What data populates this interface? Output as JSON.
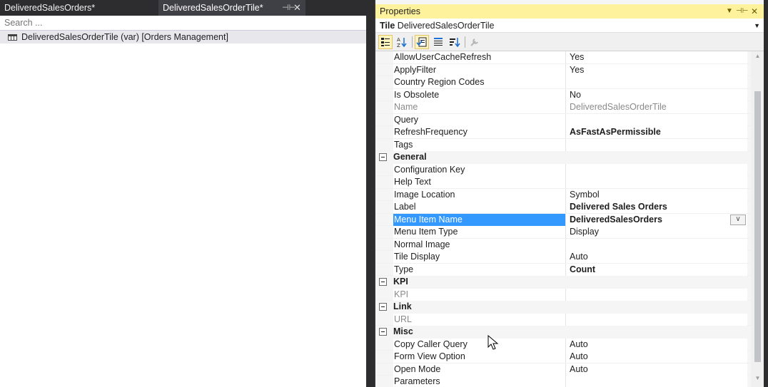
{
  "editor": {
    "tabs": [
      {
        "label": "DeliveredSalesOrders*"
      },
      {
        "label": "DeliveredSalesOrderTile*",
        "pin_icon": "pin-icon",
        "close_icon": "close-icon"
      }
    ],
    "search_placeholder": "Search ...",
    "tree_root": "DeliveredSalesOrderTile (var) [Orders Management]"
  },
  "properties": {
    "title": "Properties",
    "object_type": "Tile",
    "object_name": "DeliveredSalesOrderTile",
    "toolbar_icons": [
      "categorized-icon",
      "alphabetical-icon",
      "properties-icon",
      "events-icon",
      "sort-icon",
      "property-pages-icon"
    ],
    "rows": [
      {
        "name": "AllowUserCacheRefresh",
        "value": "Yes"
      },
      {
        "name": "ApplyFilter",
        "value": "Yes"
      },
      {
        "name": "Country Region Codes",
        "value": ""
      },
      {
        "name": "Is Obsolete",
        "value": "No"
      },
      {
        "name": "Name",
        "value": "DeliveredSalesOrderTile"
      },
      {
        "name": "Query",
        "value": ""
      },
      {
        "name": "RefreshFrequency",
        "value": "AsFastAsPermissible"
      },
      {
        "name": "Tags",
        "value": ""
      }
    ],
    "categories": {
      "general": {
        "label": "General",
        "rows": [
          {
            "name": "Configuration Key",
            "value": ""
          },
          {
            "name": "Help Text",
            "value": ""
          },
          {
            "name": "Image Location",
            "value": "Symbol"
          },
          {
            "name": "Label",
            "value": "Delivered Sales Orders"
          },
          {
            "name": "Menu Item Name",
            "value": "DeliveredSalesOrders"
          },
          {
            "name": "Menu Item Type",
            "value": "Display"
          },
          {
            "name": "Normal Image",
            "value": ""
          },
          {
            "name": "Tile Display",
            "value": "Auto"
          },
          {
            "name": "Type",
            "value": "Count"
          }
        ]
      },
      "kpi": {
        "label": "KPI",
        "rows": [
          {
            "name": "KPI",
            "value": ""
          }
        ]
      },
      "link": {
        "label": "Link",
        "rows": [
          {
            "name": "URL",
            "value": ""
          }
        ]
      },
      "misc": {
        "label": "Misc",
        "rows": [
          {
            "name": "Copy Caller Query",
            "value": "Auto"
          },
          {
            "name": "Form View Option",
            "value": "Auto"
          },
          {
            "name": "Open Mode",
            "value": "Auto"
          },
          {
            "name": "Parameters",
            "value": ""
          }
        ]
      }
    },
    "selected_row": "Menu Item Name"
  },
  "colors": {
    "title_bar": "#fff29d",
    "selection": "#3399ff",
    "ide_background": "#2d2d30"
  }
}
